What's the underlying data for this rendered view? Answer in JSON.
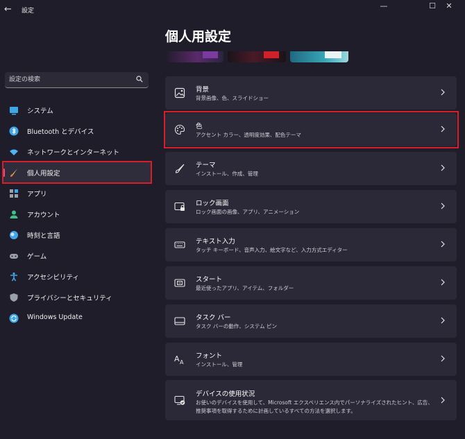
{
  "window": {
    "app_title": "設定",
    "back_glyph": "←",
    "minimize_glyph": "—",
    "maximize_glyph": "☐",
    "close_glyph": "✕"
  },
  "page": {
    "title": "個人用設定"
  },
  "search": {
    "placeholder": "設定の検索",
    "icon": "search-icon"
  },
  "sidebar": {
    "items": [
      {
        "label": "システム",
        "icon": "system-icon",
        "selected": false
      },
      {
        "label": "Bluetooth とデバイス",
        "icon": "bluetooth-icon",
        "selected": false
      },
      {
        "label": "ネットワークとインターネット",
        "icon": "network-icon",
        "selected": false
      },
      {
        "label": "個人用設定",
        "icon": "personalization-brush-icon",
        "selected": true
      },
      {
        "label": "アプリ",
        "icon": "apps-icon",
        "selected": false
      },
      {
        "label": "アカウント",
        "icon": "account-icon",
        "selected": false
      },
      {
        "label": "時刻と言語",
        "icon": "time-language-icon",
        "selected": false
      },
      {
        "label": "ゲーム",
        "icon": "gaming-icon",
        "selected": false
      },
      {
        "label": "アクセシビリティ",
        "icon": "accessibility-icon",
        "selected": false
      },
      {
        "label": "プライバシーとセキュリティ",
        "icon": "shield-icon",
        "selected": false
      },
      {
        "label": "Windows Update",
        "icon": "windows-update-icon",
        "selected": false
      }
    ]
  },
  "cards": [
    {
      "title": "背景",
      "subtitle": "背景画像、色、スライドショー",
      "icon": "background-image-icon"
    },
    {
      "title": "色",
      "subtitle": "アクセント カラー、透明度効果、配色テーマ",
      "icon": "palette-icon"
    },
    {
      "title": "テーマ",
      "subtitle": "インストール、作成、管理",
      "icon": "brush-icon"
    },
    {
      "title": "ロック画面",
      "subtitle": "ロック画面の画像、アプリ、アニメーション",
      "icon": "lock-screen-icon"
    },
    {
      "title": "テキスト入力",
      "subtitle": "タッチ キーボード、音声入力、絵文字など、入力方式エディター",
      "icon": "keyboard-icon"
    },
    {
      "title": "スタート",
      "subtitle": "最近使ったアプリ、アイテム、フォルダー",
      "icon": "start-icon"
    },
    {
      "title": "タスク バー",
      "subtitle": "タスク バーの動作、システム ピン",
      "icon": "taskbar-icon"
    },
    {
      "title": "フォント",
      "subtitle": "インストール、管理",
      "icon": "font-icon"
    },
    {
      "title": "デバイスの使用状況",
      "subtitle": "お使いのデバイスを使用して、Microsoft エクスペリエンス内でパーソナライズされたヒント、広告、推奨事項を取得するために計画しているすべての方法を選択します。",
      "icon": "device-usage-icon"
    }
  ],
  "colors": {
    "background": "#1f1d2a",
    "card": "#2b2937",
    "highlight": "#d81f27",
    "selected_indicator": "#e0508a"
  }
}
